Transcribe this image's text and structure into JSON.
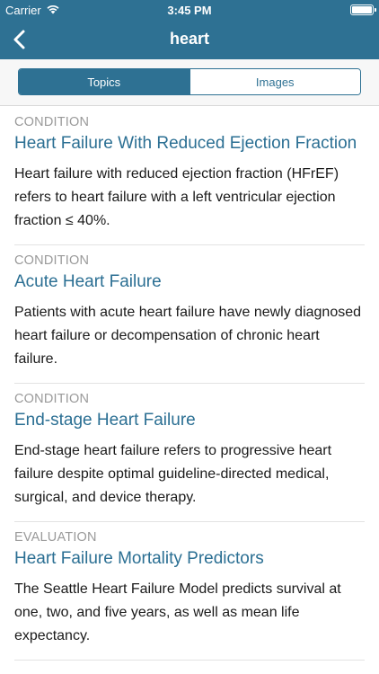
{
  "status_bar": {
    "carrier": "Carrier",
    "time": "3:45 PM",
    "wifi_icon": "wifi-icon",
    "battery_icon": "battery-icon"
  },
  "nav": {
    "title": "heart",
    "back_icon": "chevron-left-icon"
  },
  "segments": {
    "topics": "Topics",
    "images": "Images",
    "selected": "Topics"
  },
  "results": [
    {
      "category": "CONDITION",
      "title": "Heart Failure With Reduced Ejection Fraction",
      "description": "Heart failure with reduced ejection fraction (HFrEF) refers to heart failure with a left ventricular ejection fraction ≤ 40%."
    },
    {
      "category": "CONDITION",
      "title": "Acute Heart Failure",
      "description": "Patients with acute heart failure have newly diagnosed heart failure or decompensation of chronic heart failure."
    },
    {
      "category": "CONDITION",
      "title": "End-stage Heart Failure",
      "description": "End-stage heart failure refers to progressive heart failure despite optimal guideline-directed medical, surgical, and device therapy."
    },
    {
      "category": "EVALUATION",
      "title": "Heart Failure Mortality Predictors",
      "description": "The Seattle Heart Failure Model predicts survival at one, two, and five years, as well as mean life expectancy."
    }
  ],
  "colors": {
    "brand": "#2e7193",
    "link": "#2b6f93",
    "category": "#9a9a9a"
  }
}
